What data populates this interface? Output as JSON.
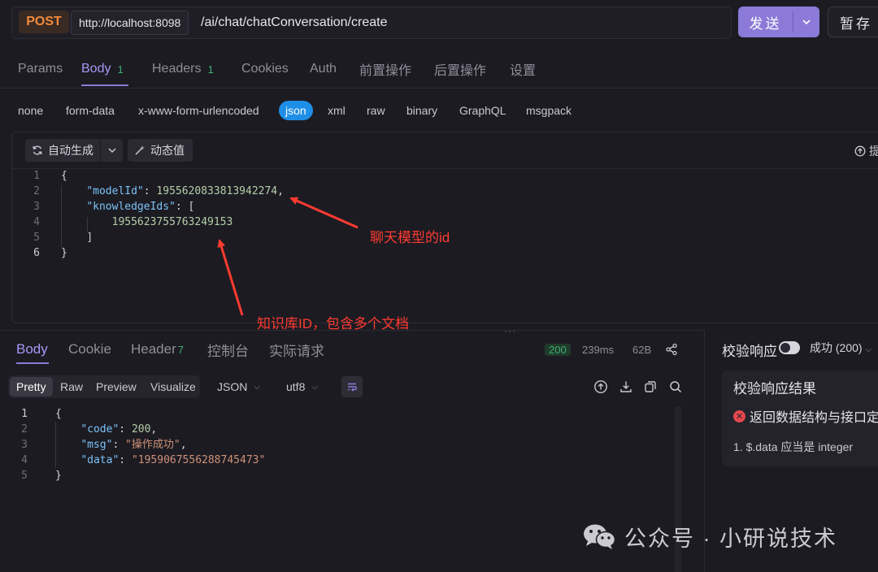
{
  "request": {
    "method": "POST",
    "host": "http://localhost:8098",
    "path": "/ai/chat/chatConversation/create",
    "send_label": "发送",
    "save_label": "暂存"
  },
  "req_tabs": [
    {
      "label": "Params"
    },
    {
      "label": "Body",
      "count": "1"
    },
    {
      "label": "Headers",
      "count": "1"
    },
    {
      "label": "Cookies"
    },
    {
      "label": "Auth"
    },
    {
      "label": "前置操作"
    },
    {
      "label": "后置操作"
    },
    {
      "label": "设置"
    }
  ],
  "body_types": [
    "none",
    "form-data",
    "x-www-form-urlencoded",
    "json",
    "xml",
    "raw",
    "binary",
    "GraphQL",
    "msgpack"
  ],
  "selected_body_type": "json",
  "editor": {
    "autogen_label": "自动生成",
    "dynamic_label": "动态值",
    "right_action_label": "提",
    "line_numbers": [
      "1",
      "2",
      "3",
      "4",
      "5",
      "6"
    ],
    "lines": {
      "l1": "{",
      "model_key": "\"modelId\"",
      "model_val": "1955620833813942274",
      "kb_key": "\"knowledgeIds\"",
      "kb_open": "[",
      "kb_val": "1955623755763249153",
      "kb_close": "]",
      "l6": "}"
    }
  },
  "annotations": {
    "model_note": "聊天模型的id",
    "kb_note": "知识库ID，包含多个文档"
  },
  "response": {
    "tabs": [
      {
        "label": "Body"
      },
      {
        "label": "Cookie"
      },
      {
        "label": "Header",
        "count": "7"
      },
      {
        "label": "控制台"
      },
      {
        "label": "实际请求"
      }
    ],
    "status": "200",
    "time": "239ms",
    "size": "62B",
    "views": [
      "Pretty",
      "Raw",
      "Preview",
      "Visualize"
    ],
    "active_view": "Pretty",
    "format": "JSON",
    "encoding": "utf8",
    "line_numbers": [
      "1",
      "2",
      "3",
      "4",
      "5"
    ],
    "lines": {
      "l1": "{",
      "code_key": "\"code\"",
      "code_val": "200",
      "msg_key": "\"msg\"",
      "msg_val": "\"操作成功\"",
      "data_key": "\"data\"",
      "data_val": "\"1959067556288745473\"",
      "l5": "}"
    }
  },
  "validation": {
    "title": "校验响应",
    "status": "成功 (200)",
    "result_title": "校验响应结果",
    "error_text": "返回数据结构与接口定",
    "item": "1. $.data 应当是 integer"
  },
  "watermark": "公众号 · 小研说技术",
  "colors": {
    "accent": "#8b7ad8",
    "method": "#f08a3c",
    "success": "#3fb070",
    "annotation": "#ff3b30",
    "json_selected": "#1f8ee6"
  }
}
